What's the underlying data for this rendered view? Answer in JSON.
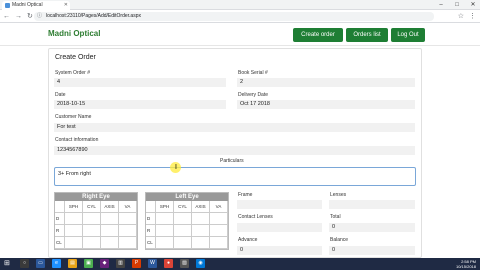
{
  "browser": {
    "tab_title": "Madni Optical",
    "url": "localhost:23110/Pages/Add/EditOrder.aspx",
    "info_icon": "info-icon"
  },
  "navbar": {
    "brand": "Madni Optical",
    "create_order": "Create order",
    "orders_list": "Orders list",
    "log_out": "Log Out",
    "accent": "#1e7e34"
  },
  "form": {
    "title": "Create Order",
    "system_order_label": "System Order #",
    "system_order_value": "4",
    "book_serial_label": "Book Serial #",
    "book_serial_value": "2",
    "date_label": "Date",
    "date_value": "2018-10-15",
    "delivery_date_label": "Delivery Date",
    "delivery_date_value": "Oct 17 2018",
    "customer_name_label": "Customer Name",
    "customer_name_value": "For test",
    "contact_label": "Contact information",
    "contact_value": "1234567890",
    "particulars_label": "Particulars",
    "particulars_value": "3+ From right",
    "right_eye": {
      "title": "Right Eye",
      "columns": [
        "SPH",
        "CYL",
        "AXIS",
        "VA"
      ],
      "rows": [
        "D",
        "R",
        "CL"
      ]
    },
    "left_eye": {
      "title": "Left Eye",
      "columns": [
        "SPH",
        "CYL",
        "AXIS",
        "VA"
      ],
      "rows": [
        "D",
        "R",
        "CL"
      ]
    },
    "frame_label": "Frame",
    "lenses_label": "Lenses",
    "contact_lenses_label": "Contact Lenses",
    "total_label": "Total",
    "total_value": "0",
    "advance_label": "Advance",
    "advance_value": "0",
    "balance_label": "Balance",
    "balance_value": "0"
  },
  "taskbar": {
    "time": "2:58 PM",
    "date": "10/15/2018"
  }
}
